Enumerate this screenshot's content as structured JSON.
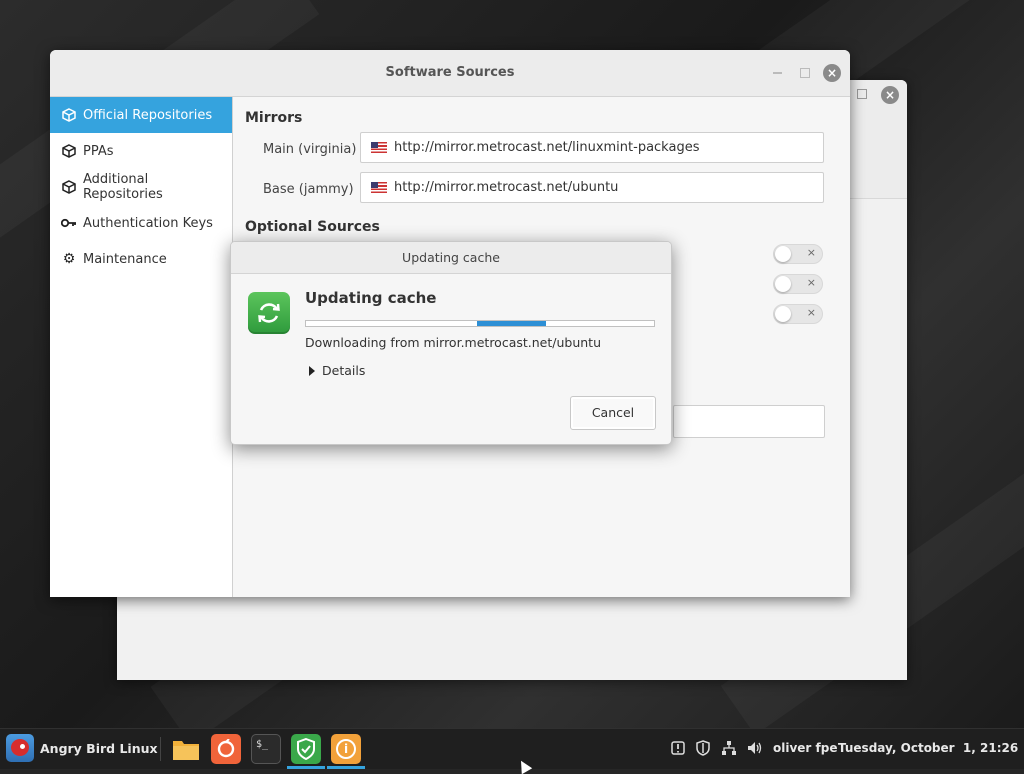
{
  "main_window": {
    "title": "Software Sources",
    "controls": {
      "minimize_icon": "minimize-icon",
      "maximize_icon": "maximize-icon",
      "close_icon": "close-icon",
      "close_glyph": "×"
    }
  },
  "sidebar": {
    "items": [
      {
        "label": "Official Repositories",
        "icon": "package-icon",
        "active": true
      },
      {
        "label": "PPAs",
        "icon": "package-icon",
        "active": false
      },
      {
        "label": "Additional Repositories",
        "icon": "package-icon",
        "active": false
      },
      {
        "label": "Authentication Keys",
        "icon": "key-icon",
        "active": false
      },
      {
        "label": "Maintenance",
        "icon": "gear-icon",
        "active": false
      }
    ]
  },
  "mirrors": {
    "section_title": "Mirrors",
    "main": {
      "label": "Main (virginia)",
      "url": "http://mirror.metrocast.net/linuxmint-packages",
      "flag": "us-flag-icon"
    },
    "base": {
      "label": "Base (jammy)",
      "url": "http://mirror.metrocast.net/ubuntu",
      "flag": "us-flag-icon"
    }
  },
  "optional_sources": {
    "section_title": "Optional Sources",
    "toggles": [
      {
        "state": "off",
        "glyph": "×"
      },
      {
        "state": "off",
        "glyph": "×"
      },
      {
        "state": "off",
        "glyph": "×"
      }
    ]
  },
  "dialog": {
    "title": "Updating cache",
    "heading": "Updating cache",
    "icon": "refresh-icon",
    "progress": {
      "mode": "indeterminate",
      "bar_fraction": 0.2
    },
    "status": "Downloading from mirror.metrocast.net/ubuntu",
    "details_label": "Details",
    "cancel_label": "Cancel"
  },
  "back_window": {
    "close_glyph": "×"
  },
  "taskbar": {
    "menu_label": "Angry Bird Linux",
    "launchers": [
      {
        "name": "files-icon",
        "color": "#f2b13a"
      },
      {
        "name": "firefox-icon",
        "color": "#f0643a"
      },
      {
        "name": "terminal-icon",
        "color": "#2b2b2b",
        "glyph": "$_"
      },
      {
        "name": "shield-icon",
        "color": "#3aa84a"
      },
      {
        "name": "info-icon",
        "color": "#f2a13a",
        "glyph": "i"
      }
    ],
    "tray": [
      "notification-icon",
      "shield-tray-icon",
      "network-icon",
      "volume-icon"
    ],
    "user": "oliver fpe",
    "clock": "Tuesday, October  1, 21:26"
  },
  "colors": {
    "accent": "#35a3de",
    "progress": "#2d8fd5",
    "icon_green": "#3aa84a"
  }
}
